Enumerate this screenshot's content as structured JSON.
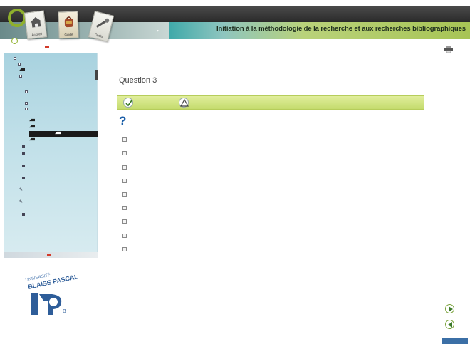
{
  "header": {
    "title": "Initiation à la méthodologie de la recherche et aux recherches bibliographiques",
    "tabs": [
      {
        "label": "Accueil",
        "icon": "house-icon"
      },
      {
        "label": "Guide",
        "icon": "backpack-icon"
      },
      {
        "label": "Outils",
        "icon": "tools-icon"
      }
    ]
  },
  "toolbar": {
    "print_icon": "printer-icon"
  },
  "main": {
    "question_title": "Question 3",
    "tabs": [
      {
        "icon": "checkmark-icon"
      },
      {
        "icon": "warning-icon"
      }
    ],
    "options": [
      {
        "checked": false
      },
      {
        "checked": false
      },
      {
        "checked": false
      },
      {
        "checked": false
      },
      {
        "checked": false
      },
      {
        "checked": false
      },
      {
        "checked": false
      },
      {
        "checked": false
      },
      {
        "checked": false
      }
    ]
  },
  "colors": {
    "accent_green": "#b6cd5b",
    "title_teal": "#3fa9a9",
    "question_blue": "#1c5fa8",
    "selection_black": "#1a1a1a"
  },
  "logo": {
    "text_line1": "UNIVERSITÉ",
    "text_line2": "BLAISE PASCAL",
    "mark": "B"
  }
}
